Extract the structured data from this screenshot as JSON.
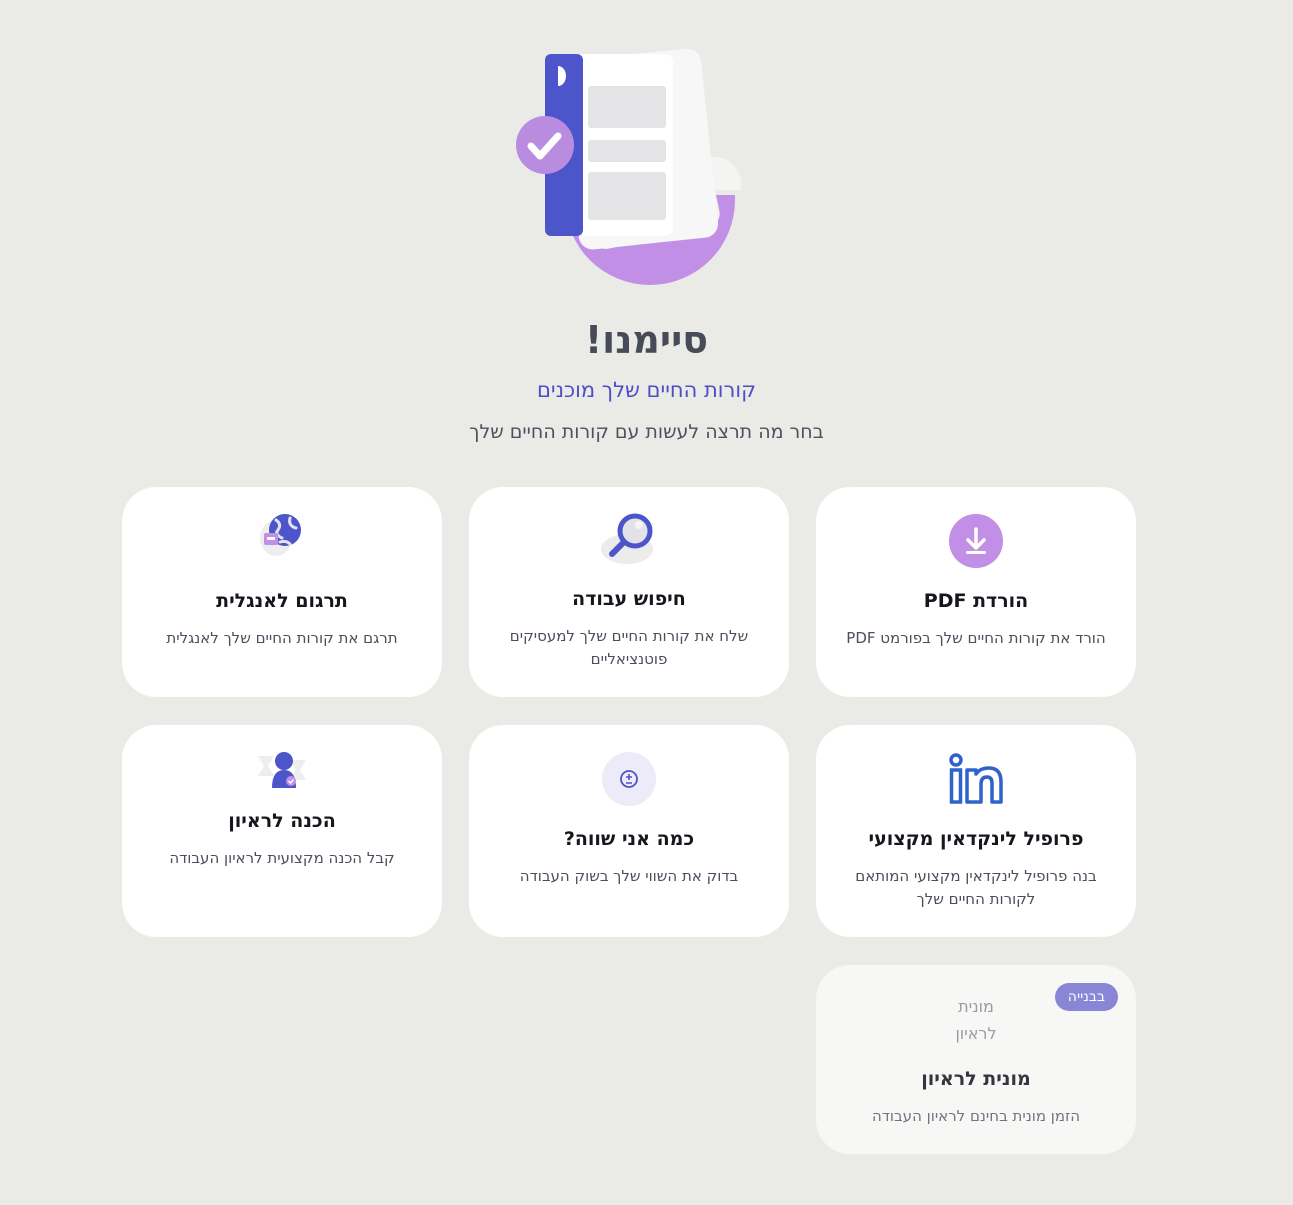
{
  "header": {
    "title": "סיימנו!",
    "subtitle": "קורות החיים שלך מוכנים",
    "description": "בחר מה תרצה לעשות עם קורות החיים שלך"
  },
  "colors": {
    "background": "#eaeae6",
    "accent": "#4e4ec6",
    "purple": "#c18fe6",
    "badge": "#8a86d6"
  },
  "cards": [
    {
      "icon": "download-icon",
      "title": "הורדת PDF",
      "description": "הורד את קורות החיים שלך בפורמט PDF"
    },
    {
      "icon": "magnifier-icon",
      "title": "חיפוש עבודה",
      "description": "שלח את קורות החיים שלך למעסיקים פוטנציאליים"
    },
    {
      "icon": "globe-translate-icon",
      "title": "תרגום לאנגלית",
      "description": "תרגם את קורות החיים שלך לאנגלית"
    },
    {
      "icon": "linkedin-icon",
      "title": "פרופיל לינקדאין מקצועי",
      "description": "בנה פרופיל לינקדאין מקצועי המותאם לקורות החיים שלך"
    },
    {
      "icon": "salary-icon",
      "title": "כמה אני שווה?",
      "description": "בדוק את השווי שלך בשוק העבודה"
    },
    {
      "icon": "interview-person-icon",
      "title": "הכנה לראיון",
      "description": "קבל הכנה מקצועית לראיון העבודה"
    },
    {
      "icon": "taxi-image-placeholder",
      "image_alt": "מונית לראיון",
      "title": "מונית לראיון",
      "description": "הזמן מונית בחינם לראיון העבודה",
      "badge": "בבנייה"
    }
  ]
}
